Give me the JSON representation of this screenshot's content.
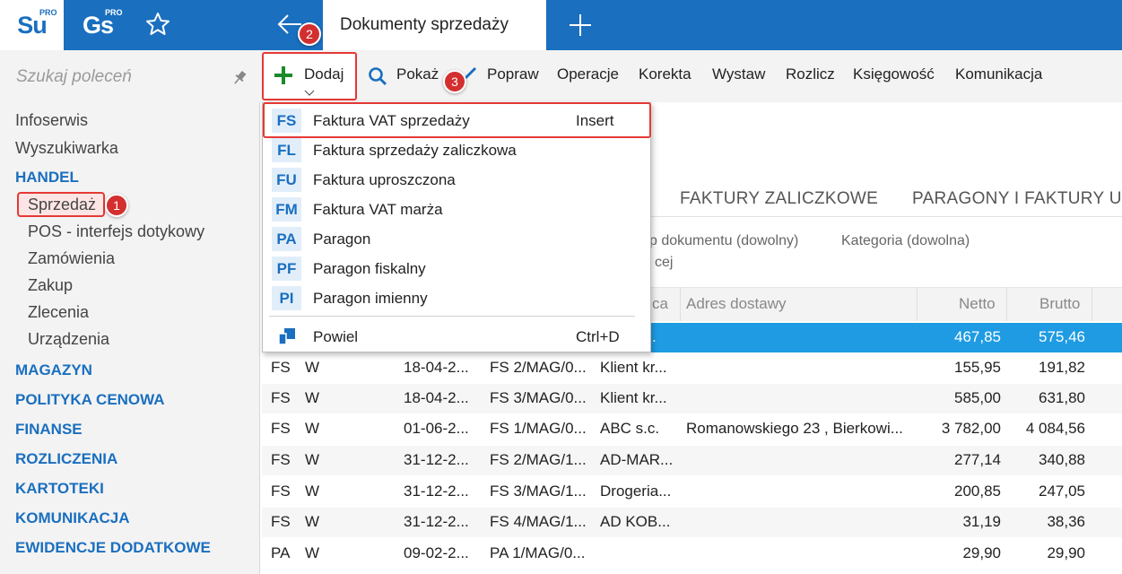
{
  "topbar": {
    "logo1": "Su",
    "logo1_pro": "PRO",
    "logo2": "Gs",
    "logo2_pro": "PRO",
    "active_tab": "Dokumenty sprzedaży"
  },
  "command_search": {
    "placeholder": "Szukaj poleceń"
  },
  "toolbar": {
    "add": "Dodaj",
    "show": "Pokaż",
    "edit": "Popraw",
    "operations": "Operacje",
    "correction": "Korekta",
    "issue": "Wystaw",
    "settle": "Rozlicz",
    "accounting": "Księgowość",
    "communication": "Komunikacja"
  },
  "badges": {
    "b1": "1",
    "b2": "2",
    "b3": "3"
  },
  "sidebar": {
    "items_top": [
      "Infoserwis",
      "Wyszukiwarka"
    ],
    "handel": "HANDEL",
    "handel_items": [
      "Sprzedaż",
      "POS - interfejs dotykowy",
      "Zamówienia",
      "Zakup",
      "Zlecenia",
      "Urządzenia"
    ],
    "sections": [
      "MAGAZYN",
      "POLITYKA CENOWA",
      "FINANSE",
      "ROZLICZENIA",
      "KARTOTEKI",
      "KOMUNIKACJA",
      "EWIDENCJE DODATKOWE"
    ]
  },
  "content_tabs": [
    "FAKTURY ZALICZKOWE",
    "PARAGONY I FAKTURY UP"
  ],
  "filters": {
    "doc_type": "p dokumentu (dowolny)",
    "category": "Kategoria (dowolna)",
    "second_line": "cej"
  },
  "columns": {
    "col_a": "ca",
    "address": "Adres dostawy",
    "net": "Netto",
    "gross": "Brutto"
  },
  "rows": [
    {
      "t": "",
      "s": "",
      "d": "",
      "n": "",
      "c": ".",
      "a": "",
      "net": "467,85",
      "gross": "575,46"
    },
    {
      "t": "FS",
      "s": "W",
      "d": "18-04-2...",
      "n": "FS 2/MAG/0...",
      "c": "Klient kr...",
      "a": "",
      "net": "155,95",
      "gross": "191,82"
    },
    {
      "t": "FS",
      "s": "W",
      "d": "18-04-2...",
      "n": "FS 3/MAG/0...",
      "c": "Klient kr...",
      "a": "",
      "net": "585,00",
      "gross": "631,80"
    },
    {
      "t": "FS",
      "s": "W",
      "d": "01-06-2...",
      "n": "FS 1/MAG/0...",
      "c": "ABC s.c.",
      "a": "Romanowskiego 23 , Bierkowi...",
      "net": "3 782,00",
      "gross": "4 084,56"
    },
    {
      "t": "FS",
      "s": "W",
      "d": "31-12-2...",
      "n": "FS 2/MAG/1...",
      "c": "AD-MAR...",
      "a": "",
      "net": "277,14",
      "gross": "340,88"
    },
    {
      "t": "FS",
      "s": "W",
      "d": "31-12-2...",
      "n": "FS 3/MAG/1...",
      "c": "Drogeria...",
      "a": "",
      "net": "200,85",
      "gross": "247,05"
    },
    {
      "t": "FS",
      "s": "W",
      "d": "31-12-2...",
      "n": "FS 4/MAG/1...",
      "c": "AD KOB...",
      "a": "",
      "net": "31,19",
      "gross": "38,36"
    },
    {
      "t": "PA",
      "s": "W",
      "d": "09-02-2...",
      "n": "PA 1/MAG/0...",
      "c": "",
      "a": "",
      "net": "29,90",
      "gross": "29,90"
    }
  ],
  "menu": {
    "items": [
      {
        "code": "FS",
        "label": "Faktura VAT sprzedaży",
        "shortcut": "Insert"
      },
      {
        "code": "FL",
        "label": "Faktura sprzedaży zaliczkowa",
        "shortcut": ""
      },
      {
        "code": "FU",
        "label": "Faktura uproszczona",
        "shortcut": ""
      },
      {
        "code": "FM",
        "label": "Faktura VAT marża",
        "shortcut": ""
      },
      {
        "code": "PA",
        "label": "Paragon",
        "shortcut": ""
      },
      {
        "code": "PF",
        "label": "Paragon fiskalny",
        "shortcut": ""
      },
      {
        "code": "PI",
        "label": "Paragon imienny",
        "shortcut": ""
      }
    ],
    "duplicate": {
      "label": "Powiel",
      "shortcut": "Ctrl+D"
    }
  },
  "colors": {
    "brand": "#1a6fbf",
    "selected_row": "#1e9be2",
    "highlight": "#e53935"
  }
}
